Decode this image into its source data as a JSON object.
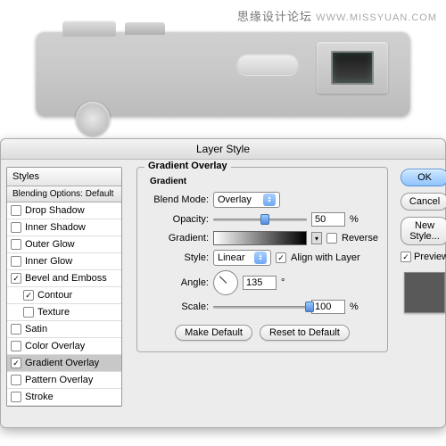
{
  "watermark": {
    "cn": "思缘设计论坛",
    "en": "WWW.MISSYUAN.COM"
  },
  "dialog": {
    "title": "Layer Style",
    "styles_header": "Styles",
    "blending_label": "Blending Options: Default",
    "items": [
      {
        "label": "Drop Shadow",
        "checked": false,
        "indent": false
      },
      {
        "label": "Inner Shadow",
        "checked": false,
        "indent": false
      },
      {
        "label": "Outer Glow",
        "checked": false,
        "indent": false
      },
      {
        "label": "Inner Glow",
        "checked": false,
        "indent": false
      },
      {
        "label": "Bevel and Emboss",
        "checked": true,
        "indent": false
      },
      {
        "label": "Contour",
        "checked": true,
        "indent": true
      },
      {
        "label": "Texture",
        "checked": false,
        "indent": true
      },
      {
        "label": "Satin",
        "checked": false,
        "indent": false
      },
      {
        "label": "Color Overlay",
        "checked": false,
        "indent": false
      },
      {
        "label": "Gradient Overlay",
        "checked": true,
        "indent": false,
        "selected": true
      },
      {
        "label": "Pattern Overlay",
        "checked": false,
        "indent": false
      },
      {
        "label": "Stroke",
        "checked": false,
        "indent": false
      }
    ]
  },
  "overlay": {
    "section_title": "Gradient Overlay",
    "sub_title": "Gradient",
    "blend_label": "Blend Mode:",
    "blend_value": "Overlay",
    "opacity_label": "Opacity:",
    "opacity_value": "50",
    "pct": "%",
    "gradient_label": "Gradient:",
    "reverse_label": "Reverse",
    "style_label": "Style:",
    "style_value": "Linear",
    "align_label": "Align with Layer",
    "angle_label": "Angle:",
    "angle_value": "135",
    "deg": "°",
    "scale_label": "Scale:",
    "scale_value": "100",
    "make_default": "Make Default",
    "reset_default": "Reset to Default"
  },
  "buttons": {
    "ok": "OK",
    "cancel": "Cancel",
    "new_style": "New Style...",
    "preview": "Preview"
  }
}
